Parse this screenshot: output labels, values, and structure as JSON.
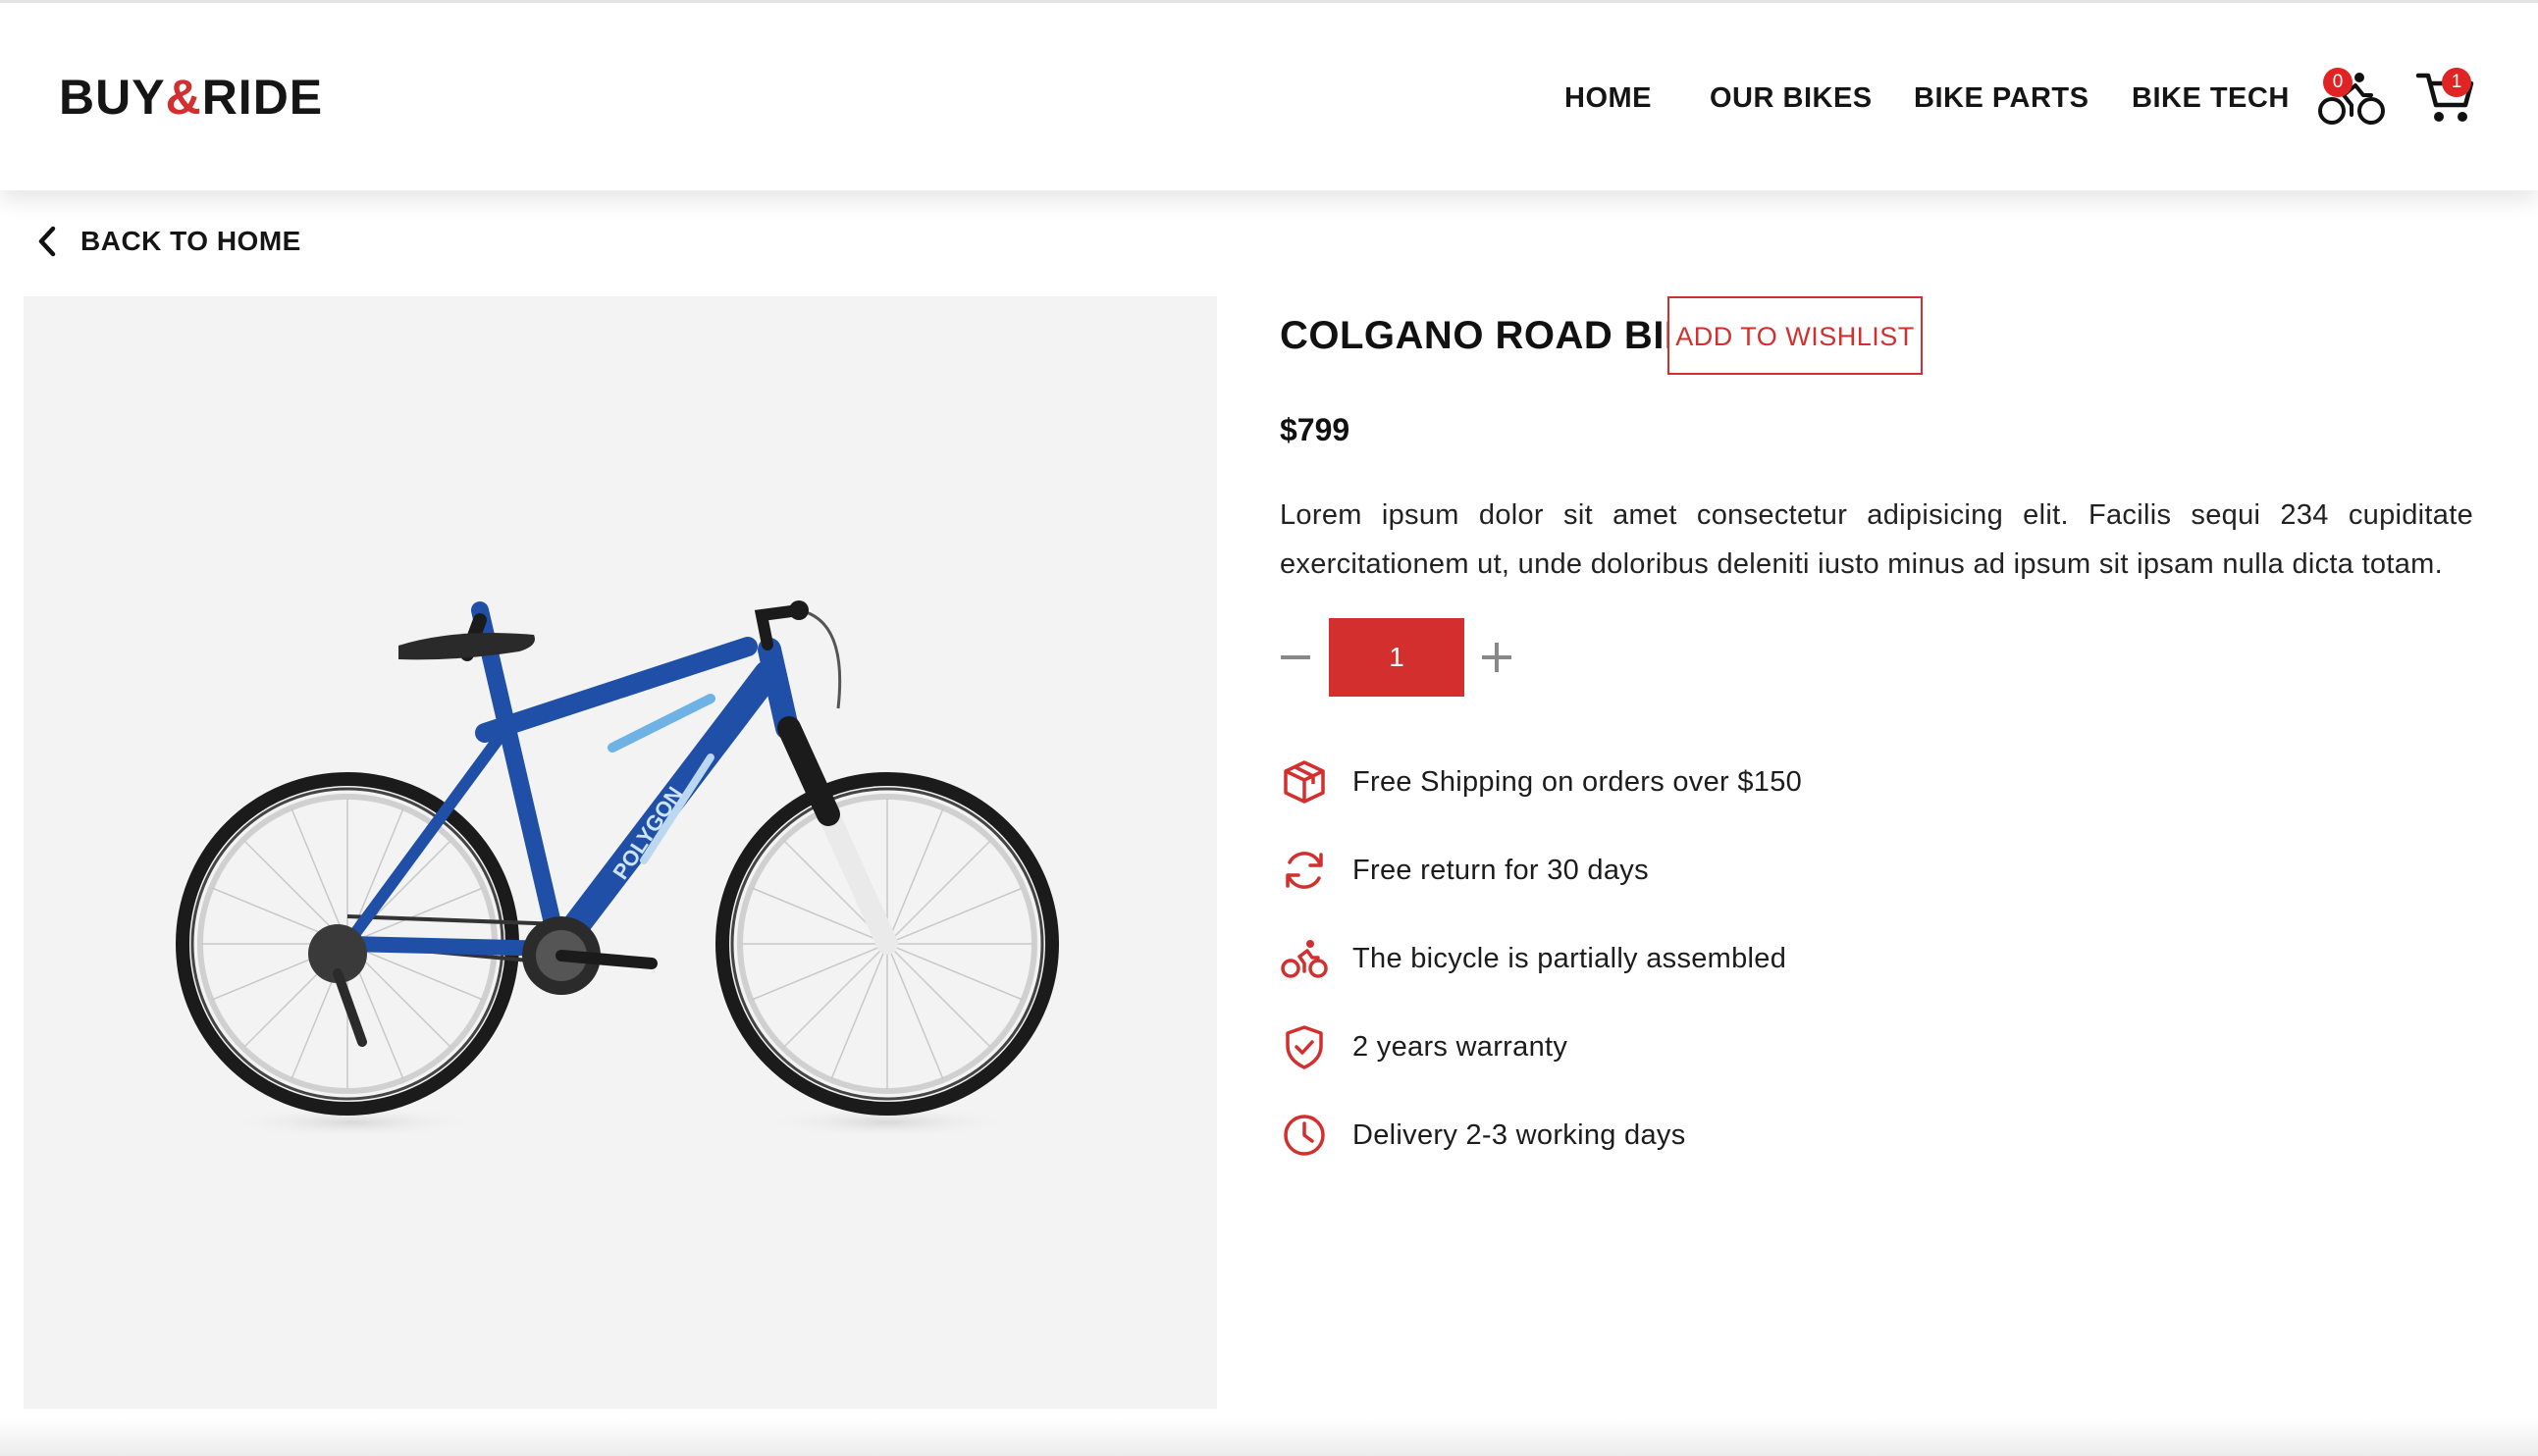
{
  "header": {
    "logo_left": "BUY",
    "logo_amp": "&",
    "logo_right": "RIDE",
    "nav": [
      "HOME",
      "OUR BIKES",
      "BIKE PARTS",
      "BIKE TECH"
    ],
    "wishlist_count": "0",
    "cart_count": "1",
    "wishlist_icon": "bicycle-icon",
    "cart_icon": "cart-icon"
  },
  "back": {
    "label": "BACK TO HOME",
    "icon": "chevron-left-icon"
  },
  "product": {
    "title": "COLGANO ROAD BIKE",
    "wishlist_label": "ADD TO WISHLIST",
    "price": "$799",
    "description": "Lorem ipsum dolor sit amet consectetur adipisicing elit. Facilis sequi 234 cupiditate exercitationem ut, unde doloribus deleniti iusto minus ad ipsum sit ipsam nulla dicta totam.",
    "quantity": "1",
    "image_icon": "bicycle-photo",
    "brand_text": "POLYGON"
  },
  "features": [
    {
      "icon": "package-icon",
      "text": "Free Shipping on orders over $150"
    },
    {
      "icon": "refresh-icon",
      "text": "Free return for 30 days"
    },
    {
      "icon": "bicycle-icon",
      "text": "The bicycle is partially assembled"
    },
    {
      "icon": "shield-check-icon",
      "text": "2 years warranty"
    },
    {
      "icon": "clock-icon",
      "text": "Delivery 2-3 working days"
    }
  ],
  "colors": {
    "accent": "#d32f2f",
    "text": "#111111",
    "image_bg": "#f3f3f3",
    "bike_frame": "#1f4fa6"
  }
}
